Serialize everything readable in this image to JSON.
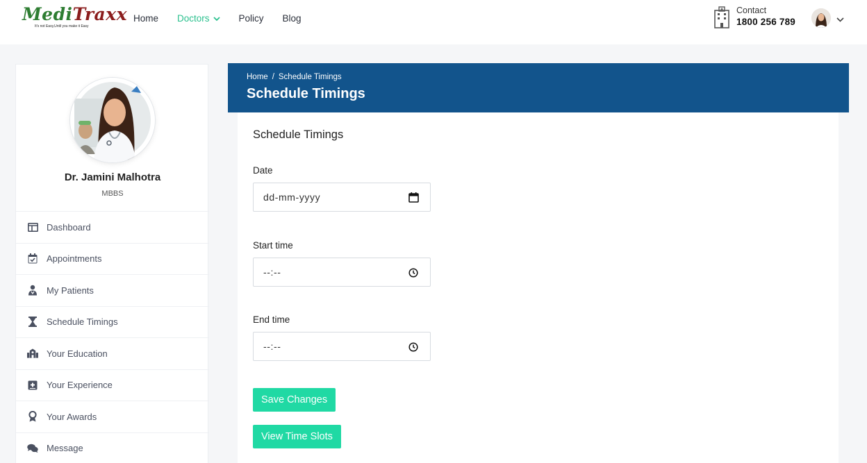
{
  "brand": {
    "name_part1": "Medi",
    "name_part2": "Traxx",
    "tagline": "It's not Easy,Until you make it Easy"
  },
  "nav": {
    "items": [
      {
        "label": "Home",
        "active": false
      },
      {
        "label": "Doctors",
        "active": true,
        "has_dropdown": true
      },
      {
        "label": "Policy",
        "active": false
      },
      {
        "label": "Blog",
        "active": false
      }
    ]
  },
  "contact": {
    "label": "Contact",
    "phone": "1800 256 789",
    "icon": "hospital-icon"
  },
  "user_menu": {
    "avatar": "avatar",
    "icon": "chevron-down-icon"
  },
  "sidebar": {
    "doctor_name": "Dr. Jamini Malhotra",
    "degree": "MBBS",
    "items": [
      {
        "label": "Dashboard",
        "icon": "dashboard-icon"
      },
      {
        "label": "Appointments",
        "icon": "calendar-check-icon"
      },
      {
        "label": "My Patients",
        "icon": "patients-icon"
      },
      {
        "label": "Schedule Timings",
        "icon": "hourglass-icon"
      },
      {
        "label": "Your Education",
        "icon": "school-icon"
      },
      {
        "label": "Your Experience",
        "icon": "medical-book-icon"
      },
      {
        "label": "Your Awards",
        "icon": "award-icon"
      },
      {
        "label": "Message",
        "icon": "chat-icon"
      }
    ]
  },
  "banner": {
    "breadcrumb": [
      "Home",
      "/",
      "Schedule Timings"
    ],
    "title": "Schedule Timings"
  },
  "form": {
    "title": "Schedule Timings",
    "date_label": "Date",
    "date_placeholder": "dd-mm-yyyy",
    "start_label": "Start time",
    "start_placeholder": "--:--",
    "end_label": "End time",
    "end_placeholder": "--:--",
    "save_button": "Save Changes",
    "view_button": "View Time Slots"
  },
  "colors": {
    "accent": "#20d9a4",
    "nav_active": "#2bc08e",
    "banner": "#12548c",
    "logo_green": "#2e7d32",
    "logo_red": "#8b1d1d"
  }
}
